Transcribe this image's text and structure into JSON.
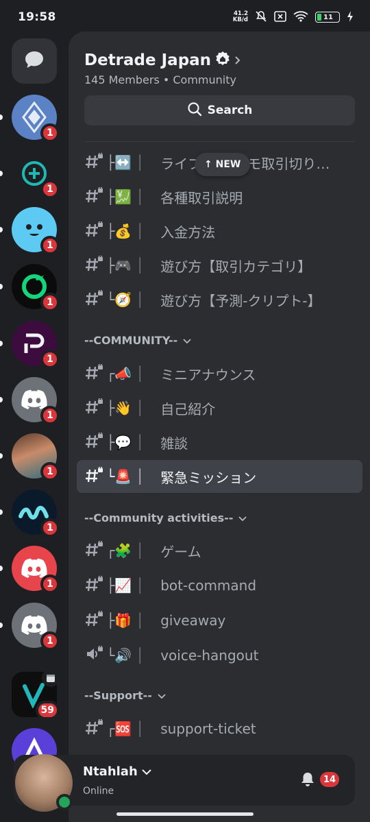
{
  "status_bar": {
    "time": "19:58",
    "net_speed_value": "41.2",
    "net_speed_unit": "KB/d",
    "battery": "11"
  },
  "server": {
    "name": "Detrade Japan",
    "meta": "145 Members  •  Community",
    "search_label": "Search"
  },
  "new_pill_label": "↑ NEW",
  "channels": [
    {
      "prefix": "├↔️",
      "label": "ライブ取引-デモ取引切り…"
    },
    {
      "prefix": "├💹",
      "label": "各種取引説明"
    },
    {
      "prefix": "├💰",
      "label": "入金方法"
    },
    {
      "prefix": "├🎮",
      "label": "遊び方【取引カテゴリ】"
    },
    {
      "prefix": "└🧭",
      "label": "遊び方【予測-クリプト-】"
    }
  ],
  "category_community": "--COMMUNITY--",
  "community_channels": [
    {
      "prefix": "┌📣",
      "label": "ミニアナウンス"
    },
    {
      "prefix": "├👋",
      "label": "自己紹介"
    },
    {
      "prefix": "├💬",
      "label": "雑談"
    },
    {
      "prefix": "└🚨",
      "label": "緊急ミッション"
    }
  ],
  "category_activities": "--Community activities--",
  "activity_channels": [
    {
      "prefix": "┌🧩",
      "label": "ゲーム"
    },
    {
      "prefix": "├📈",
      "label": "bot-command"
    },
    {
      "prefix": "├🎁",
      "label": "giveaway"
    },
    {
      "prefix": "└🔊",
      "label": "voice-hangout"
    }
  ],
  "category_support": "--Support--",
  "support_channels": [
    {
      "prefix": "┌🆘",
      "label": "support-ticket"
    }
  ],
  "rail_badges": [
    "1",
    "1",
    "1",
    "1",
    "1",
    "1",
    "1",
    "1",
    "1",
    "1",
    "59"
  ],
  "user": {
    "name": "Ntahlah",
    "status": "Online",
    "notifications": "14"
  },
  "colors": {
    "accent": "#5865f2",
    "badge": "#da373c",
    "online": "#23a55a"
  }
}
